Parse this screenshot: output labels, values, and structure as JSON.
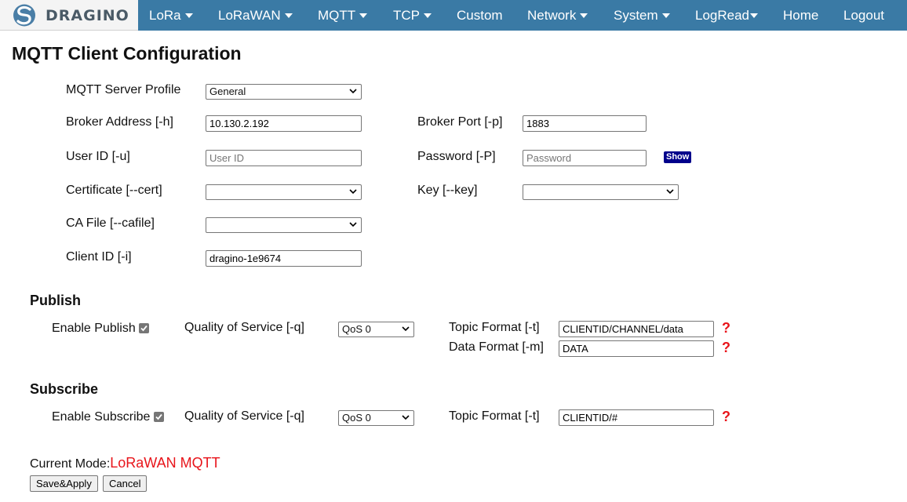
{
  "brand": {
    "name": "DRAGINO",
    "logo_icon": "dragino-swirl-icon",
    "accent": "#3a7aa5"
  },
  "nav": {
    "lora": "LoRa",
    "lorawan": "LoRaWAN",
    "mqtt": "MQTT",
    "tcp": "TCP",
    "custom": "Custom",
    "network": "Network",
    "system": "System",
    "logread": "LogRead",
    "home": "Home",
    "logout": "Logout"
  },
  "page_title": "MQTT Client Configuration",
  "form": {
    "server_profile": {
      "label": "MQTT Server Profile",
      "value": "General"
    },
    "broker_address": {
      "label": "Broker Address [-h]",
      "value": "10.130.2.192"
    },
    "broker_port": {
      "label": "Broker Port [-p]",
      "value": "1883"
    },
    "user_id": {
      "label": "User ID [-u]",
      "placeholder": "User ID"
    },
    "password": {
      "label": "Password [-P]",
      "placeholder": "Password",
      "show_label": "Show"
    },
    "certificate": {
      "label": "Certificate [--cert]",
      "value": ""
    },
    "key": {
      "label": "Key [--key]",
      "value": ""
    },
    "ca_file": {
      "label": "CA File [--cafile]",
      "value": ""
    },
    "client_id": {
      "label": "Client ID [-i]",
      "value": "dragino-1e9674"
    }
  },
  "publish": {
    "heading": "Publish",
    "enable_label": "Enable Publish",
    "enabled": true,
    "qos_label": "Quality of Service [-q]",
    "qos_value": "QoS 0",
    "topic_label": "Topic Format [-t]",
    "topic_value": "CLIENTID/CHANNEL/data",
    "data_label": "Data Format [-m]",
    "data_value": "DATA",
    "help": "?"
  },
  "subscribe": {
    "heading": "Subscribe",
    "enable_label": "Enable Subscribe",
    "enabled": true,
    "qos_label": "Quality of Service [-q]",
    "qos_value": "QoS 0",
    "topic_label": "Topic Format [-t]",
    "topic_value": "CLIENTID/#",
    "help": "?"
  },
  "mode": {
    "label": "Current Mode:",
    "value": "LoRaWAN MQTT",
    "value_color": "#e8141a"
  },
  "buttons": {
    "save": "Save&Apply",
    "cancel": "Cancel"
  }
}
